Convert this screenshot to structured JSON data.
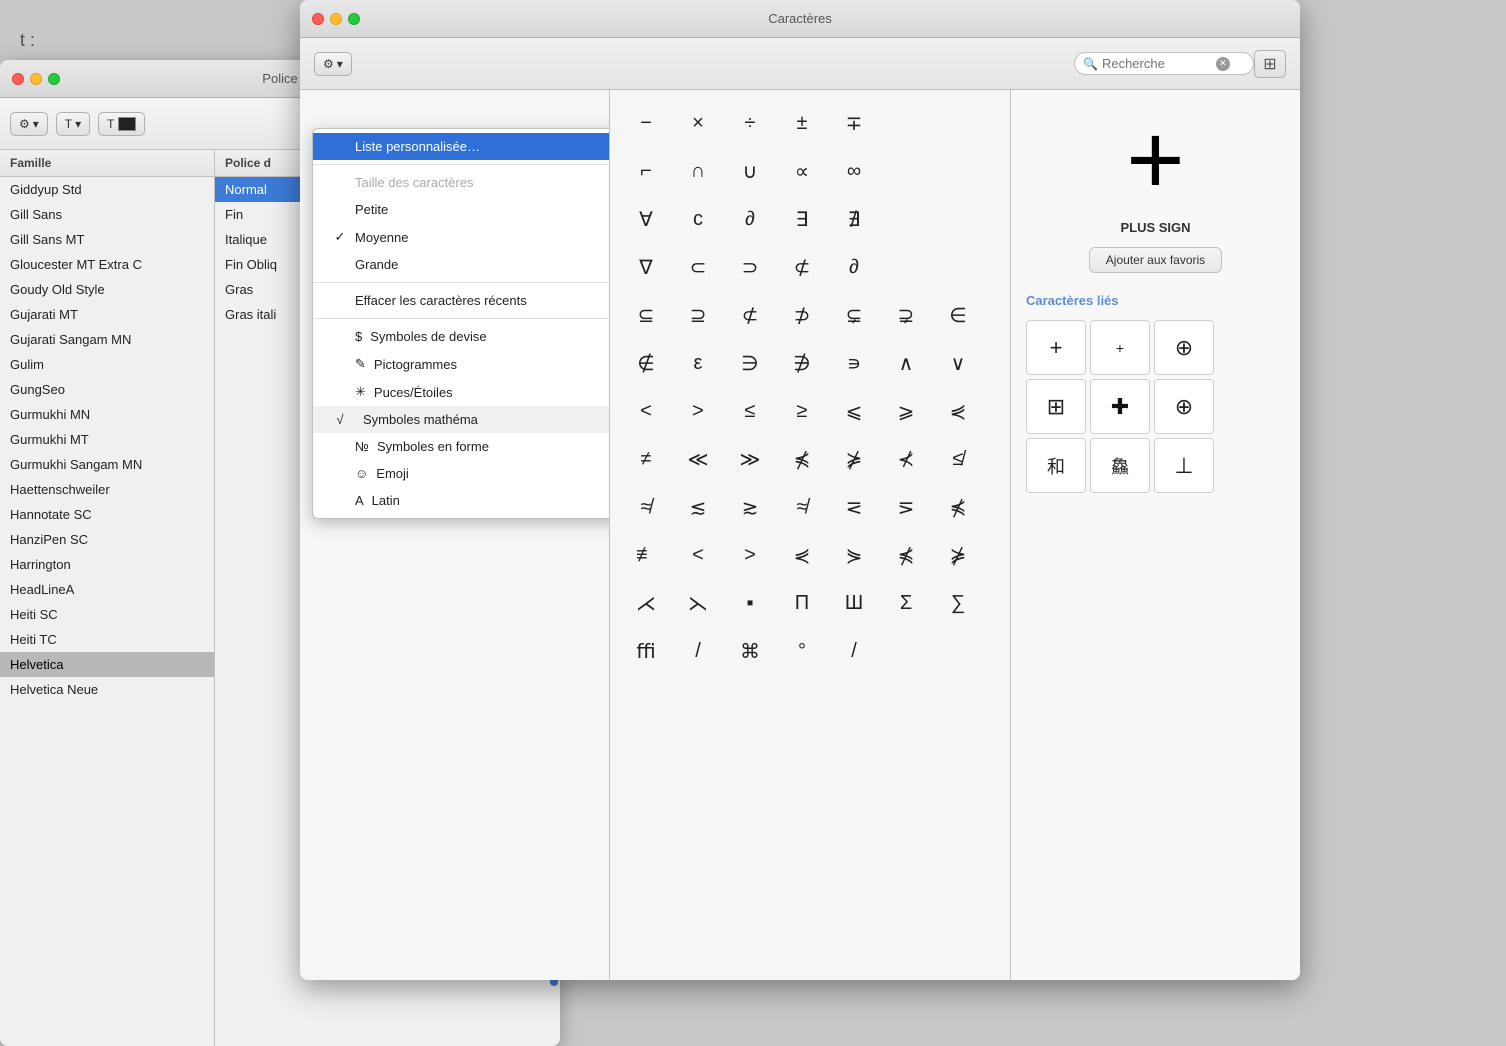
{
  "bgWindow": {
    "title": "Police",
    "dots": [
      "red",
      "yellow",
      "green"
    ],
    "columns": {
      "famille": {
        "header": "Famille",
        "items": [
          {
            "label": "Giddyup Std",
            "selected": false
          },
          {
            "label": "Gill Sans",
            "selected": false
          },
          {
            "label": "Gill Sans MT",
            "selected": false
          },
          {
            "label": "Gloucester MT Extra C",
            "selected": false
          },
          {
            "label": "Goudy Old Style",
            "selected": false
          },
          {
            "label": "Gujarati MT",
            "selected": false
          },
          {
            "label": "Gujarati Sangam MN",
            "selected": false
          },
          {
            "label": "Gulim",
            "selected": false
          },
          {
            "label": "GungSeo",
            "selected": false
          },
          {
            "label": "Gurmukhi MN",
            "selected": false
          },
          {
            "label": "Gurmukhi MT",
            "selected": false
          },
          {
            "label": "Gurmukhi Sangam MN",
            "selected": false
          },
          {
            "label": "Haettenschweiler",
            "selected": false
          },
          {
            "label": "Hannotate SC",
            "selected": false
          },
          {
            "label": "HanziPen SC",
            "selected": false
          },
          {
            "label": "Harrington",
            "selected": false
          },
          {
            "label": "HeadLineA",
            "selected": false
          },
          {
            "label": "Heiti SC",
            "selected": false
          },
          {
            "label": "Heiti TC",
            "selected": false
          },
          {
            "label": "Helvetica",
            "selected": true
          },
          {
            "label": "Helvetica Neue",
            "selected": false
          }
        ]
      },
      "police": {
        "header": "Police d",
        "items": [
          {
            "label": "Normal",
            "selected": true
          },
          {
            "label": "Fin",
            "selected": false
          },
          {
            "label": "Italique",
            "selected": false
          },
          {
            "label": "Fin Obliq",
            "selected": false
          },
          {
            "label": "Gras",
            "selected": false
          },
          {
            "label": "Gras itali",
            "selected": false
          }
        ]
      }
    }
  },
  "mainWindow": {
    "title": "Caractères",
    "searchPlaceholder": "Recherche",
    "toolbar": {
      "gearLabel": "⚙",
      "chevronLabel": "▾"
    },
    "dropdown": {
      "items": [
        {
          "id": "liste-personnalisee",
          "label": "Liste personnalisée…",
          "highlighted": true,
          "disabled": false,
          "check": ""
        },
        {
          "id": "separator1",
          "type": "separator"
        },
        {
          "id": "taille-header",
          "label": "Taille des caractères",
          "type": "section-header"
        },
        {
          "id": "petite",
          "label": "Petite",
          "check": ""
        },
        {
          "id": "moyenne",
          "label": "Moyenne",
          "check": "✓"
        },
        {
          "id": "grande",
          "label": "Grande",
          "check": ""
        },
        {
          "id": "separator2",
          "type": "separator"
        },
        {
          "id": "effacer",
          "label": "Effacer les caractères récents",
          "check": ""
        },
        {
          "id": "separator3",
          "type": "separator"
        },
        {
          "id": "symboles-devise",
          "label": "Symboles de devise",
          "icon": "$",
          "check": ""
        },
        {
          "id": "pictogrammes",
          "label": "Pictogrammes",
          "icon": "✎",
          "check": ""
        },
        {
          "id": "puces-etoiles",
          "label": "Puces/Étoiles",
          "icon": "✳",
          "check": ""
        },
        {
          "id": "symboles-math",
          "label": "Symboles mathéma",
          "icon": "√",
          "check": "✓"
        },
        {
          "id": "symboles-forme",
          "label": "Symboles en forme",
          "icon": "№",
          "check": ""
        },
        {
          "id": "emoji",
          "label": "Emoji",
          "icon": "☺",
          "check": ""
        },
        {
          "id": "latin",
          "label": "Latin",
          "icon": "A",
          "check": ""
        }
      ]
    },
    "symbols": {
      "rows": [
        [
          "−",
          "×",
          "÷",
          "±",
          "∓"
        ],
        [
          "⌐",
          "∩",
          "∪",
          "∝",
          "∞"
        ],
        [
          "∀",
          "ϲ",
          "∂",
          "∃",
          "∄"
        ],
        [
          "∇",
          "⊂",
          "⊃",
          "⊄",
          "∂"
        ],
        [
          "⊆",
          "⊇",
          "⊄",
          "⊅",
          "⊊",
          "⊋",
          "∈"
        ],
        [
          "∉",
          "ε",
          "∋",
          "∌",
          "∍",
          "∧",
          "∨"
        ],
        [
          "<",
          ">",
          "≤",
          "≥",
          "⩽",
          "⩾",
          "⋞"
        ],
        [
          "≠",
          "≪",
          "≫",
          "⋠",
          "⋡",
          "⊀",
          "≰"
        ],
        [
          "≉",
          "≲",
          "≳",
          "≉",
          "⋜",
          "⋝",
          "⋠"
        ],
        [
          "≢",
          "<",
          ">",
          "⋞",
          "⋟",
          "⋠",
          "⋡"
        ],
        [
          "⋌",
          "⋋",
          "▪",
          "Π",
          "Ш",
          "Σ",
          "∑"
        ],
        [
          "ﬃ",
          "/",
          "⌘",
          "°",
          "/"
        ]
      ],
      "selectedCell": {
        "row": 0,
        "col": 0
      }
    },
    "rightPanel": {
      "bigSymbol": "+",
      "symbolName": "PLUS SIGN",
      "addFavoritesLabel": "Ajouter aux favoris",
      "relatedCharsTitle": "Caractères liés",
      "relatedChars": [
        "+",
        "+",
        "⊕",
        "⊞",
        "✚",
        "⊕",
        "和",
        "鱻",
        "⊥"
      ]
    }
  },
  "bgText": "t :"
}
